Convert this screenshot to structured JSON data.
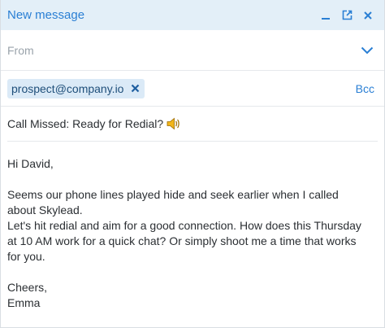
{
  "header": {
    "title": "New message",
    "icons": [
      "minimize-icon",
      "popout-icon",
      "close-icon"
    ]
  },
  "from": {
    "label": "From",
    "icon": "chevron-down-icon"
  },
  "to": {
    "recipient": "prospect@company.io",
    "remove_icon": "close-icon",
    "bcc_label": "Bcc"
  },
  "subject": {
    "text": "Call Missed: Ready for Redial?",
    "emoji_icon": "speaker-icon"
  },
  "body": {
    "greeting": "Hi David,",
    "para1_line1": "Seems our phone lines played hide and seek earlier when I called",
    "para1_line2": "about Skylead.",
    "para2_line1": "Let's hit redial and aim for a good connection. How does this Thursday",
    "para2_line2": "at 10 AM work for a quick chat? Or simply shoot me a time that works",
    "para2_line3": "for you.",
    "signoff": "Cheers,",
    "name": "Emma"
  },
  "colors": {
    "accent": "#2a7fd4",
    "header_bg": "#e3eff8",
    "chip_bg": "#dbeaf7",
    "emoji": "#f2b61b"
  }
}
